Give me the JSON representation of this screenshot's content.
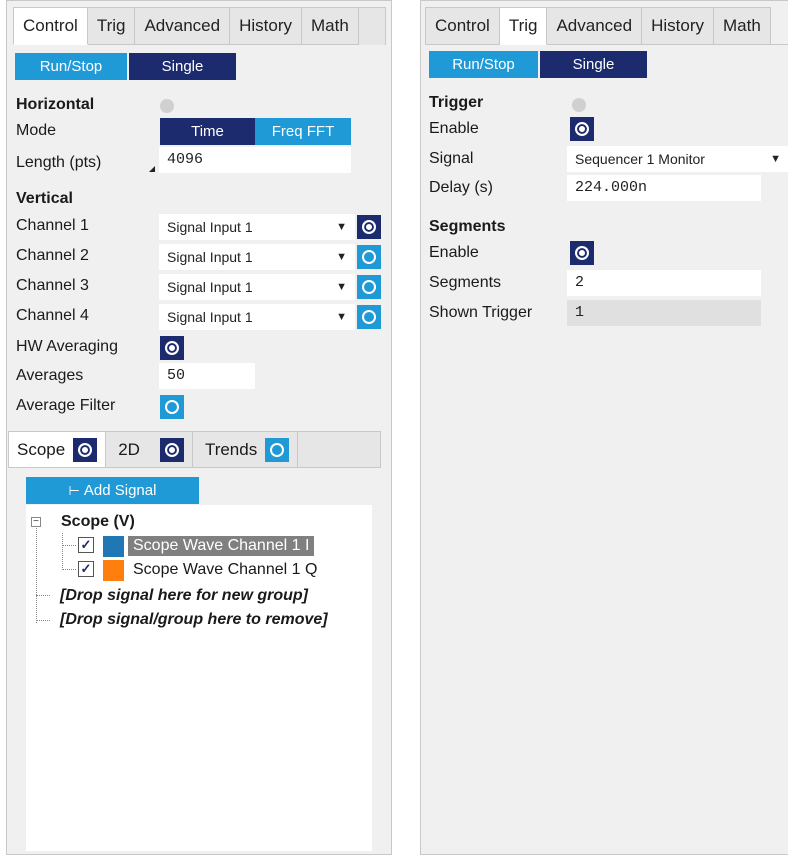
{
  "left": {
    "tabs": [
      "Control",
      "Trig",
      "Advanced",
      "History",
      "Math"
    ],
    "run_stop": "Run/Stop",
    "single": "Single",
    "horizontal": {
      "title": "Horizontal",
      "mode_label": "Mode",
      "mode_options": [
        "Time",
        "Freq FFT"
      ],
      "length_label": "Length (pts)",
      "length_value": "4096"
    },
    "vertical": {
      "title": "Vertical",
      "channels": [
        {
          "label": "Channel 1",
          "value": "Signal Input 1",
          "enabled": true
        },
        {
          "label": "Channel 2",
          "value": "Signal Input 1",
          "enabled": false
        },
        {
          "label": "Channel 3",
          "value": "Signal Input 1",
          "enabled": false
        },
        {
          "label": "Channel 4",
          "value": "Signal Input 1",
          "enabled": false
        }
      ],
      "hw_averaging_label": "HW Averaging",
      "averages_label": "Averages",
      "averages_value": "50",
      "average_filter_label": "Average Filter"
    },
    "subtabs": [
      "Scope",
      "2D",
      "Trends"
    ],
    "add_signal": "Add Signal",
    "tree": {
      "group": "Scope (V)",
      "items": [
        {
          "label": "Scope Wave Channel 1 I",
          "color": "#1f77b4"
        },
        {
          "label": "Scope Wave Channel 1 Q",
          "color": "#ff7f0e"
        }
      ],
      "drop_new": "[Drop signal here for new group]",
      "drop_remove": "[Drop signal/group here to remove]"
    }
  },
  "right": {
    "tabs": [
      "Control",
      "Trig",
      "Advanced",
      "History",
      "Math"
    ],
    "run_stop": "Run/Stop",
    "single": "Single",
    "trigger": {
      "title": "Trigger",
      "enable_label": "Enable",
      "signal_label": "Signal",
      "signal_value": "Sequencer 1 Monitor",
      "delay_label": "Delay (s)",
      "delay_value": "224.000n"
    },
    "segments": {
      "title": "Segments",
      "enable_label": "Enable",
      "segments_label": "Segments",
      "segments_value": "2",
      "shown_label": "Shown Trigger",
      "shown_value": "1"
    }
  },
  "colors": {
    "accent": "#1f9ad6",
    "dark": "#1c2b6e",
    "selected": "#808080"
  }
}
